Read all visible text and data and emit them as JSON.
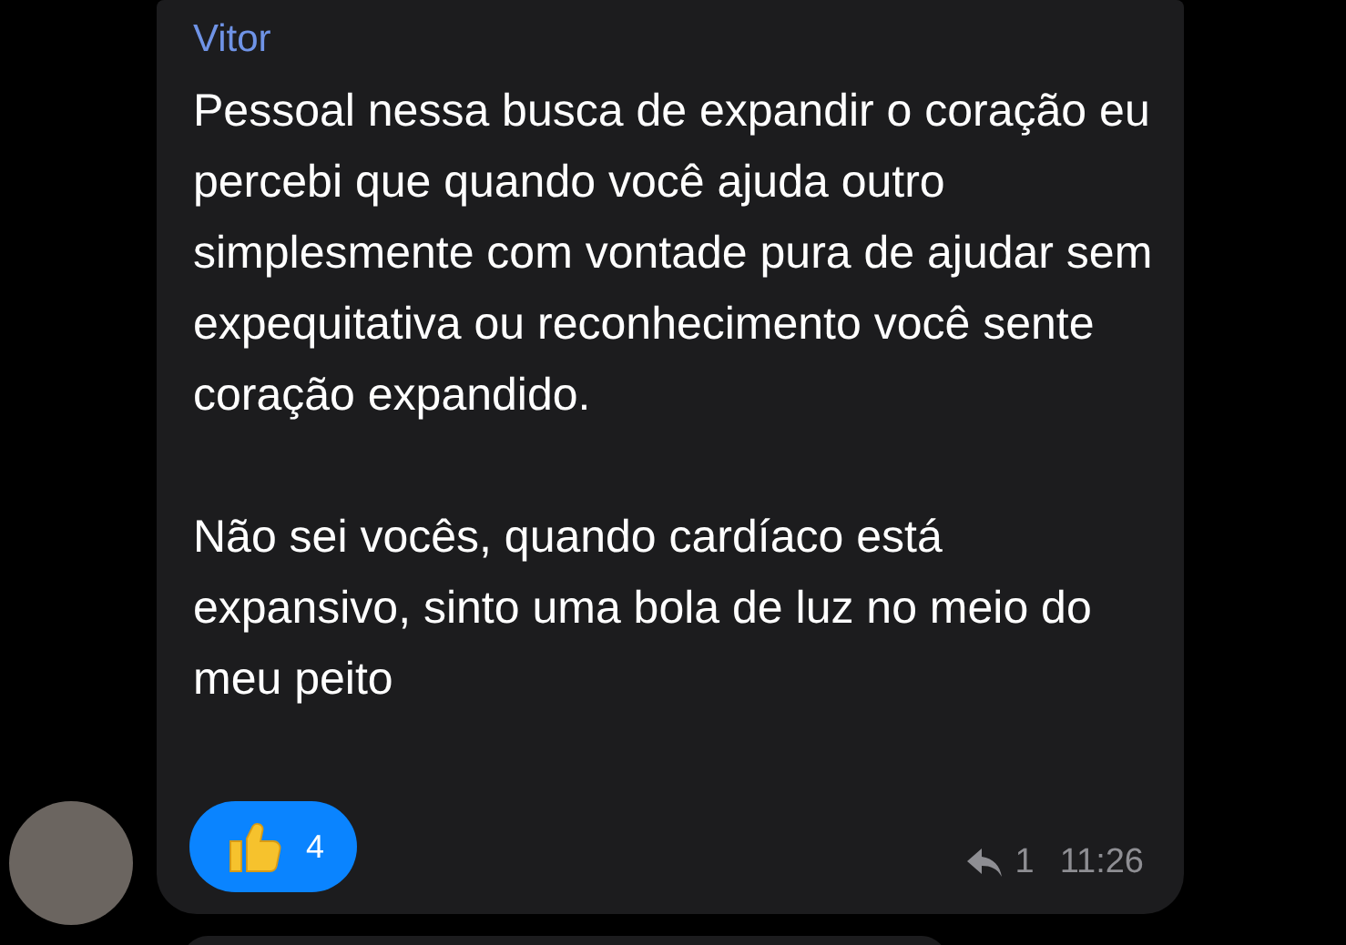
{
  "message": {
    "sender": "Vitor",
    "paragraphs": [
      "Pessoal nessa busca de expandir o coração eu percebi que quando você ajuda outro simplesmente com vontade pura de ajudar sem expequitativa ou reconhecimento você sente coração expandido.",
      "Não sei vocês, quando cardíaco está expansivo, sinto uma bola de luz no meio do meu peito"
    ],
    "reactions": [
      {
        "count": "4",
        "selected": true
      }
    ],
    "reply_count": "1",
    "time": "11:26"
  }
}
